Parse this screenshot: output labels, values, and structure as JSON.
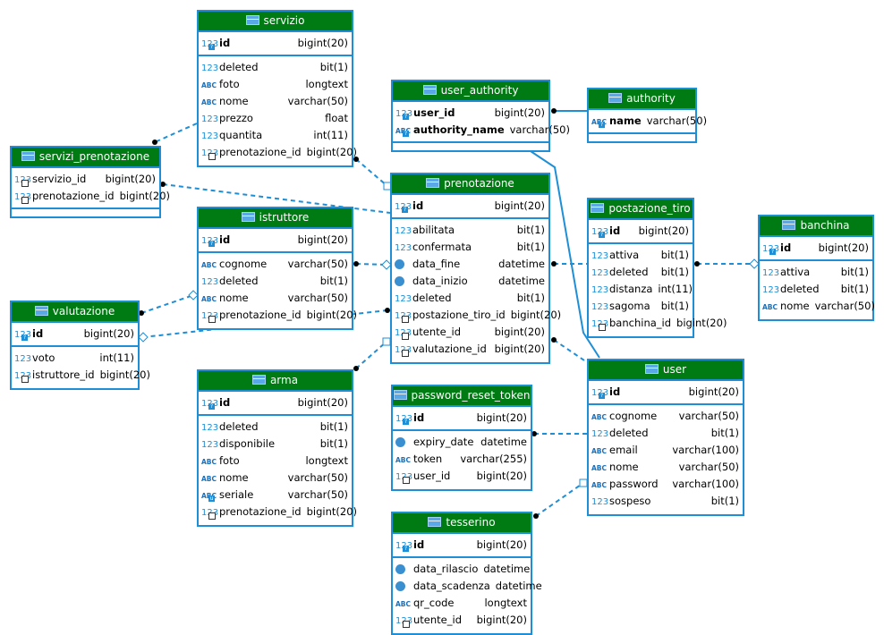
{
  "colors": {
    "header": "#007a12",
    "border": "#1e8fd6",
    "link": "#1e8fd6"
  },
  "tables": {
    "servizio": {
      "name": "servizio",
      "pk": [
        {
          "name": "id",
          "type": "bigint(20)",
          "icon": "num",
          "key": "pk"
        }
      ],
      "cols": [
        {
          "name": "deleted",
          "type": "bit(1)",
          "icon": "num"
        },
        {
          "name": "foto",
          "type": "longtext",
          "icon": "abc"
        },
        {
          "name": "nome",
          "type": "varchar(50)",
          "icon": "abc"
        },
        {
          "name": "prezzo",
          "type": "float",
          "icon": "num"
        },
        {
          "name": "quantita",
          "type": "int(11)",
          "icon": "num"
        },
        {
          "name": "prenotazione_id",
          "type": "bigint(20)",
          "icon": "num",
          "key": "fk"
        }
      ]
    },
    "servizi_prenotazione": {
      "name": "servizi_prenotazione",
      "pk": [
        {
          "name": "servizio_id",
          "type": "bigint(20)",
          "icon": "num",
          "key": "fk",
          "plain": true
        },
        {
          "name": "prenotazione_id",
          "type": "bigint(20)",
          "icon": "num",
          "key": "fk",
          "plain": true
        }
      ],
      "cols": []
    },
    "user_authority": {
      "name": "user_authority",
      "pk": [
        {
          "name": "user_id",
          "type": "bigint(20)",
          "icon": "num",
          "key": "pk"
        },
        {
          "name": "authority_name",
          "type": "varchar(50)",
          "icon": "abc",
          "key": "pk"
        }
      ],
      "cols": []
    },
    "authority": {
      "name": "authority",
      "pk": [
        {
          "name": "name",
          "type": "varchar(50)",
          "icon": "abc",
          "key": "pk"
        }
      ],
      "cols": []
    },
    "prenotazione": {
      "name": "prenotazione",
      "pk": [
        {
          "name": "id",
          "type": "bigint(20)",
          "icon": "num",
          "key": "pk"
        }
      ],
      "cols": [
        {
          "name": "abilitata",
          "type": "bit(1)",
          "icon": "num"
        },
        {
          "name": "confermata",
          "type": "bit(1)",
          "icon": "num"
        },
        {
          "name": "data_fine",
          "type": "datetime",
          "icon": "clock"
        },
        {
          "name": "data_inizio",
          "type": "datetime",
          "icon": "clock"
        },
        {
          "name": "deleted",
          "type": "bit(1)",
          "icon": "num"
        },
        {
          "name": "postazione_tiro_id",
          "type": "bigint(20)",
          "icon": "num",
          "key": "fk"
        },
        {
          "name": "utente_id",
          "type": "bigint(20)",
          "icon": "num",
          "key": "fk"
        },
        {
          "name": "valutazione_id",
          "type": "bigint(20)",
          "icon": "num",
          "key": "fk"
        }
      ]
    },
    "istruttore": {
      "name": "istruttore",
      "pk": [
        {
          "name": "id",
          "type": "bigint(20)",
          "icon": "num",
          "key": "pk"
        }
      ],
      "cols": [
        {
          "name": "cognome",
          "type": "varchar(50)",
          "icon": "abc"
        },
        {
          "name": "deleted",
          "type": "bit(1)",
          "icon": "num"
        },
        {
          "name": "nome",
          "type": "varchar(50)",
          "icon": "abc"
        },
        {
          "name": "prenotazione_id",
          "type": "bigint(20)",
          "icon": "num",
          "key": "fk"
        }
      ]
    },
    "postazione_tiro": {
      "name": "postazione_tiro",
      "pk": [
        {
          "name": "id",
          "type": "bigint(20)",
          "icon": "num",
          "key": "pk"
        }
      ],
      "cols": [
        {
          "name": "attiva",
          "type": "bit(1)",
          "icon": "num"
        },
        {
          "name": "deleted",
          "type": "bit(1)",
          "icon": "num"
        },
        {
          "name": "distanza",
          "type": "int(11)",
          "icon": "num"
        },
        {
          "name": "sagoma",
          "type": "bit(1)",
          "icon": "num"
        },
        {
          "name": "banchina_id",
          "type": "bigint(20)",
          "icon": "num",
          "key": "fk"
        }
      ]
    },
    "banchina": {
      "name": "banchina",
      "pk": [
        {
          "name": "id",
          "type": "bigint(20)",
          "icon": "num",
          "key": "pk"
        }
      ],
      "cols": [
        {
          "name": "attiva",
          "type": "bit(1)",
          "icon": "num"
        },
        {
          "name": "deleted",
          "type": "bit(1)",
          "icon": "num"
        },
        {
          "name": "nome",
          "type": "varchar(50)",
          "icon": "abc"
        }
      ]
    },
    "valutazione": {
      "name": "valutazione",
      "pk": [
        {
          "name": "id",
          "type": "bigint(20)",
          "icon": "num",
          "key": "pk"
        }
      ],
      "cols": [
        {
          "name": "voto",
          "type": "int(11)",
          "icon": "num"
        },
        {
          "name": "istruttore_id",
          "type": "bigint(20)",
          "icon": "num",
          "key": "fk"
        }
      ]
    },
    "arma": {
      "name": "arma",
      "pk": [
        {
          "name": "id",
          "type": "bigint(20)",
          "icon": "num",
          "key": "pk"
        }
      ],
      "cols": [
        {
          "name": "deleted",
          "type": "bit(1)",
          "icon": "num"
        },
        {
          "name": "disponibile",
          "type": "bit(1)",
          "icon": "num"
        },
        {
          "name": "foto",
          "type": "longtext",
          "icon": "abc"
        },
        {
          "name": "nome",
          "type": "varchar(50)",
          "icon": "abc"
        },
        {
          "name": "seriale",
          "type": "varchar(50)",
          "icon": "abc",
          "key": "uk"
        },
        {
          "name": "prenotazione_id",
          "type": "bigint(20)",
          "icon": "num",
          "key": "fk"
        }
      ]
    },
    "password_reset_token": {
      "name": "password_reset_token",
      "pk": [
        {
          "name": "id",
          "type": "bigint(20)",
          "icon": "num",
          "key": "pk"
        }
      ],
      "cols": [
        {
          "name": "expiry_date",
          "type": "datetime",
          "icon": "clock"
        },
        {
          "name": "token",
          "type": "varchar(255)",
          "icon": "abc"
        },
        {
          "name": "user_id",
          "type": "bigint(20)",
          "icon": "num",
          "key": "fk"
        }
      ]
    },
    "user": {
      "name": "user",
      "pk": [
        {
          "name": "id",
          "type": "bigint(20)",
          "icon": "num",
          "key": "pk"
        }
      ],
      "cols": [
        {
          "name": "cognome",
          "type": "varchar(50)",
          "icon": "abc"
        },
        {
          "name": "deleted",
          "type": "bit(1)",
          "icon": "num"
        },
        {
          "name": "email",
          "type": "varchar(100)",
          "icon": "abc"
        },
        {
          "name": "nome",
          "type": "varchar(50)",
          "icon": "abc"
        },
        {
          "name": "password",
          "type": "varchar(100)",
          "icon": "abc"
        },
        {
          "name": "sospeso",
          "type": "bit(1)",
          "icon": "num"
        }
      ]
    },
    "tesserino": {
      "name": "tesserino",
      "pk": [
        {
          "name": "id",
          "type": "bigint(20)",
          "icon": "num",
          "key": "pk"
        }
      ],
      "cols": [
        {
          "name": "data_rilascio",
          "type": "datetime",
          "icon": "clock"
        },
        {
          "name": "data_scadenza",
          "type": "datetime",
          "icon": "clock"
        },
        {
          "name": "qr_code",
          "type": "longtext",
          "icon": "abc"
        },
        {
          "name": "utente_id",
          "type": "bigint(20)",
          "icon": "num",
          "key": "fk"
        }
      ]
    }
  },
  "relationships": [
    {
      "from": "servizio",
      "to": "servizi_prenotazione",
      "style": "dashed"
    },
    {
      "from": "servizio",
      "to": "prenotazione",
      "style": "dashed"
    },
    {
      "from": "servizi_prenotazione",
      "to": "prenotazione",
      "style": "dashed"
    },
    {
      "from": "istruttore",
      "to": "prenotazione",
      "style": "dashed"
    },
    {
      "from": "valutazione",
      "to": "istruttore",
      "style": "dashed"
    },
    {
      "from": "prenotazione",
      "to": "valutazione",
      "style": "dashed"
    },
    {
      "from": "arma",
      "to": "prenotazione",
      "style": "dashed"
    },
    {
      "from": "prenotazione",
      "to": "postazione_tiro",
      "style": "dashed"
    },
    {
      "from": "postazione_tiro",
      "to": "banchina",
      "style": "dashed"
    },
    {
      "from": "prenotazione",
      "to": "user",
      "style": "dashed"
    },
    {
      "from": "user_authority",
      "to": "authority",
      "style": "solid"
    },
    {
      "from": "user_authority",
      "to": "user",
      "style": "solid"
    },
    {
      "from": "password_reset_token",
      "to": "user",
      "style": "dashed"
    },
    {
      "from": "tesserino",
      "to": "user",
      "style": "dashed"
    }
  ]
}
